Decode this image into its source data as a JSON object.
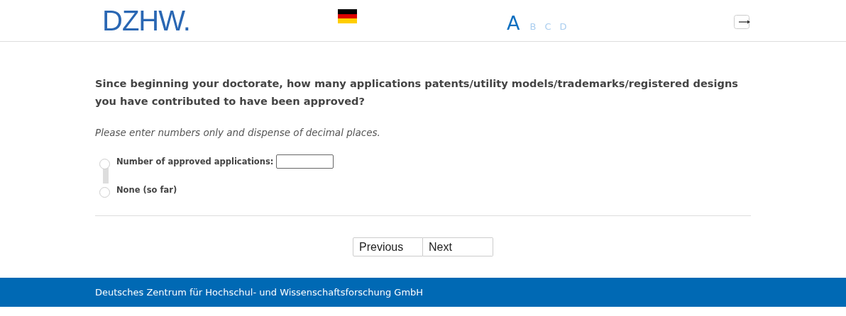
{
  "header": {
    "logo": "DZHW.",
    "language_flag": {
      "kind": "german"
    },
    "font_sizes": [
      {
        "label": "A",
        "selected": true
      },
      {
        "label": "B",
        "selected": false
      },
      {
        "label": "C",
        "selected": false
      },
      {
        "label": "D",
        "selected": false
      }
    ]
  },
  "question": {
    "text": "Since beginning your doctorate, how many applications patents/utility models/trademarks/registered designs you have contributed to have been approved?",
    "instruction": "Please enter numbers only and dispense of decimal places.",
    "options": [
      {
        "label": "Number of approved applications:",
        "selected": false,
        "kind": "with-input"
      },
      {
        "label": "None (so far)",
        "selected": false,
        "kind": "plain"
      }
    ]
  },
  "buttons": [
    {
      "label": "Previous"
    },
    {
      "label": "Next"
    }
  ],
  "footer": {
    "text": "Deutsches Zentrum für Hochschul- und Wissenschaftsforschung GmbH"
  }
}
